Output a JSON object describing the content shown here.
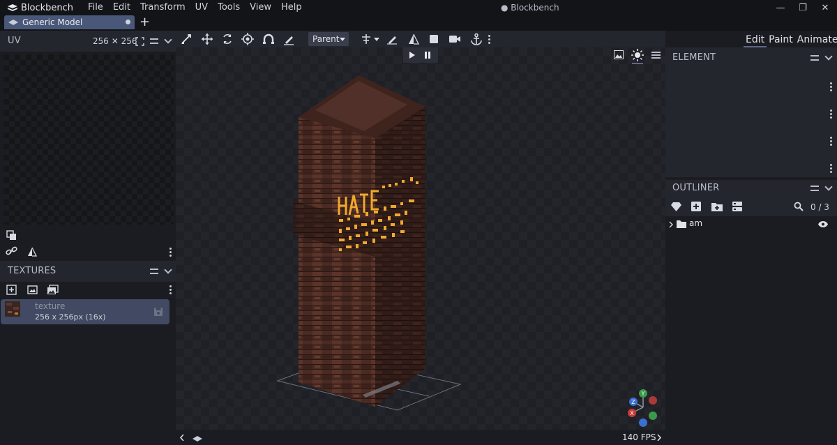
{
  "app": {
    "name": "Blockbench",
    "window_title": "● Blockbench"
  },
  "menu": [
    "File",
    "Edit",
    "Transform",
    "UV",
    "Tools",
    "View",
    "Help"
  ],
  "window_controls": {
    "minimize": "—",
    "restore": "❐",
    "close": "✕"
  },
  "tabs": [
    {
      "label": "Generic Model"
    }
  ],
  "tab_add": "+",
  "uv_panel": {
    "title": "UV",
    "size": "256 ✕ 256"
  },
  "textures_panel": {
    "title": "TEXTURES",
    "items": [
      {
        "name": "texture",
        "info": "256 x 256px (16x)"
      }
    ]
  },
  "toolbar": {
    "pivot_mode": "Parent"
  },
  "modes": [
    "Edit",
    "Paint",
    "Animate"
  ],
  "element_panel": {
    "title": "ELEMENT"
  },
  "outliner": {
    "title": "OUTLINER",
    "count": "0 / 3",
    "items": [
      {
        "label": "am"
      }
    ]
  },
  "status": {
    "fps": "140 FPS"
  },
  "colors": {
    "accent": "#495879",
    "background": "#1b1c21",
    "panel": "#24262e",
    "model_wood": "#4a2a22",
    "glow": "#f0a92d"
  },
  "gizmo_axes": [
    "X",
    "Y",
    "Z"
  ]
}
